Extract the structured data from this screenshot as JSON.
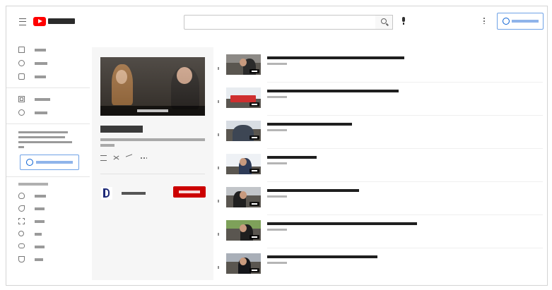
{
  "search": {
    "placeholder": ""
  },
  "header": {
    "signin_label": ""
  },
  "sidebar": {
    "items": [
      {
        "label": "",
        "icon": "home-icon"
      },
      {
        "label": "",
        "icon": "compass-icon"
      },
      {
        "label": "",
        "icon": "subscriptions-icon"
      },
      {
        "label": "",
        "icon": "library-icon"
      },
      {
        "label": "",
        "icon": "history-icon"
      }
    ],
    "promo_text": "",
    "signin_label": "",
    "section_heading": "",
    "explore_items": [
      {
        "label": "",
        "icon": "flame-icon"
      },
      {
        "label": "",
        "icon": "music-note-icon"
      },
      {
        "label": "",
        "icon": "film-icon"
      },
      {
        "label": "",
        "icon": "live-icon"
      },
      {
        "label": "",
        "icon": "gamepad-icon"
      },
      {
        "label": "",
        "icon": "trophy-icon"
      }
    ]
  },
  "playlist": {
    "play_all_label": "",
    "title": "",
    "meta": "",
    "channel_name": "",
    "subscribe_label": ""
  },
  "videos": [
    {
      "index": "",
      "title": "",
      "channel": "",
      "duration": ""
    },
    {
      "index": "",
      "title": "",
      "channel": "",
      "duration": ""
    },
    {
      "index": "",
      "title": "",
      "channel": "",
      "duration": ""
    },
    {
      "index": "",
      "title": "",
      "channel": "",
      "duration": ""
    },
    {
      "index": "",
      "title": "",
      "channel": "",
      "duration": ""
    },
    {
      "index": "",
      "title": "",
      "channel": "",
      "duration": ""
    },
    {
      "index": "",
      "title": "",
      "channel": "",
      "duration": ""
    }
  ],
  "colors": {
    "accent": "#065fd4",
    "brand": "#ff0000",
    "subscribe": "#cc0000"
  }
}
